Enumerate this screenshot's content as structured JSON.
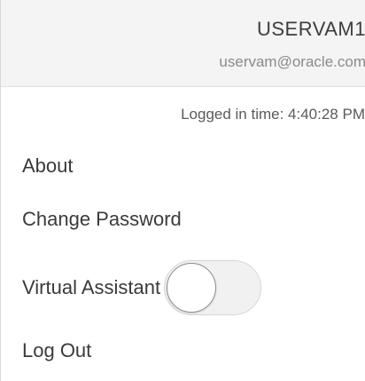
{
  "user": {
    "name": "USERVAM1",
    "email": "uservam@oracle.com",
    "logged_in_time": "Logged in time: 4:40:28 PM"
  },
  "menu": {
    "about_label": "About",
    "change_password_label": "Change Password",
    "virtual_assistant_label": "Virtual Assistant",
    "virtual_assistant_enabled": false,
    "log_out_label": "Log Out"
  }
}
